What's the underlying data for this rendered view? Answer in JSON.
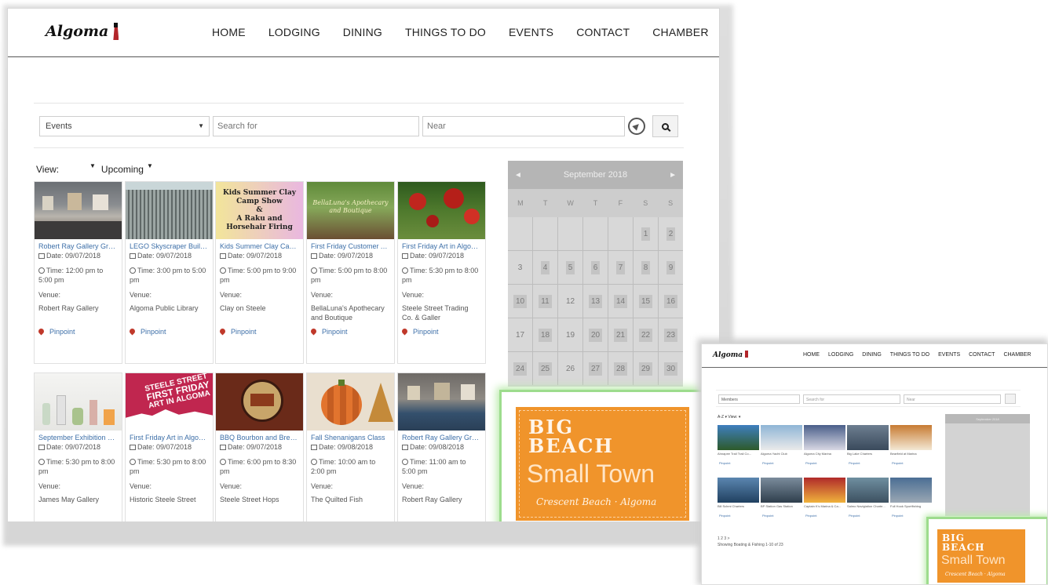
{
  "site": {
    "logo": "Algoma",
    "nav": [
      "HOME",
      "LODGING",
      "DINING",
      "THINGS TO DO",
      "EVENTS",
      "CONTACT",
      "CHAMBER"
    ]
  },
  "search": {
    "category": "Events",
    "search_placeholder": "Search for",
    "near_placeholder": "Near"
  },
  "view": {
    "label": "View:",
    "filter": "Upcoming"
  },
  "labels": {
    "venue": "Venue:",
    "pinpoint": "Pinpoint"
  },
  "events": [
    {
      "title": "Robert Ray Gallery Gran...",
      "date": "Date: 09/07/2018",
      "time": "Time: 12:00 pm to 5:00 pm",
      "venue": "Robert Ray Gallery"
    },
    {
      "title": "LEGO Skyscraper Building",
      "date": "Date: 09/07/2018",
      "time": "Time: 3:00 pm to 5:00 pm",
      "venue": "Algoma Public Library"
    },
    {
      "title": "Kids Summer Clay Cam...",
      "date": "Date: 09/07/2018",
      "time": "Time: 5:00 pm to 9:00 pm",
      "venue": "Clay on Steele"
    },
    {
      "title": "First Friday Customer A...",
      "date": "Date: 09/07/2018",
      "time": "Time: 5:00 pm to 8:00 pm",
      "venue": "BellaLuna's Apothecary and Boutique"
    },
    {
      "title": "First Friday Art in Algom...",
      "date": "Date: 09/07/2018",
      "time": "Time: 5:30 pm to 8:00 pm",
      "venue": "Steele Street Trading Co. & Galler"
    },
    {
      "title": "September Exhibition O...",
      "date": "Date: 09/07/2018",
      "time": "Time: 5:30 pm to 8:00 pm",
      "venue": "James May Gallery"
    },
    {
      "title": "First Friday Art in Algom...",
      "date": "Date: 09/07/2018",
      "time": "Time: 5:30 pm to 8:00 pm",
      "venue": "Historic Steele Street"
    },
    {
      "title": "BBQ Bourbon and Brew...",
      "date": "Date: 09/07/2018",
      "time": "Time: 6:00 pm to 8:30 pm",
      "venue": "Steele Street Hops"
    },
    {
      "title": "Fall Shenanigans Class",
      "date": "Date: 09/08/2018",
      "time": "Time: 10:00 am to 2:00 pm",
      "venue": "The Quilted Fish"
    },
    {
      "title": "Robert Ray Gallery Gran...",
      "date": "Date: 09/08/2018",
      "time": "Time: 11:00 am to 5:00 pm",
      "venue": "Robert Ray Gallery"
    }
  ],
  "event_images": {
    "kids_clay": {
      "line1": "Kids Summer Clay Camp Show",
      "line2": "&",
      "line3": "A Raku and Horsehair Firing"
    },
    "bellaluna": {
      "line1": "BellaLuna's Apothecary",
      "line2": "and Boutique"
    },
    "steele_first_friday": {
      "line1": "STEELE STREET",
      "line2": "FIRST FRIDAY",
      "line3": "ART IN ALGOMA"
    }
  },
  "calendar": {
    "month": "September 2018",
    "prev": "◄",
    "next": "►",
    "day_names": [
      "M",
      "T",
      "W",
      "T",
      "F",
      "S",
      "S"
    ],
    "weeks": [
      [
        "",
        "",
        "",
        "",
        "",
        "1",
        "2"
      ],
      [
        "3",
        "4",
        "5",
        "6",
        "7",
        "8",
        "9"
      ],
      [
        "10",
        "11",
        "12",
        "13",
        "14",
        "15",
        "16"
      ],
      [
        "17",
        "18",
        "19",
        "20",
        "21",
        "22",
        "23"
      ],
      [
        "24",
        "25",
        "26",
        "27",
        "28",
        "29",
        "30"
      ]
    ]
  },
  "promo": {
    "line1": "BIG",
    "line2": "BEACH",
    "line3": "Small Town",
    "signature": "Crescent Beach · Algoma"
  },
  "mini": {
    "category": "Members",
    "search_placeholder": "Search for",
    "near_placeholder": "Near",
    "view_row": "A-Z  ▾  View:  ▾",
    "cards": [
      "Ahnapee Trail Trail Co...",
      "Algoma Yacht Club",
      "Algoma City Marina",
      "Big Lake Charters",
      "Bearfield at Marina",
      "Bill Schmi Charters",
      "BP Station Gas Station",
      "Captain K's Marina & Ca...",
      "Salmo Naviglation Charte...",
      "Full Hook Sportfishing"
    ],
    "pinpoint": "Pinpoint",
    "pager": "1 2 3 >",
    "showing": "Showing Boating & Fishing 1-10 of 23",
    "calendar_title": "September 2018"
  },
  "colors": {
    "accent": "#3d6fa8",
    "promo": "#f0942b",
    "highlight": "#9ddc8d"
  }
}
